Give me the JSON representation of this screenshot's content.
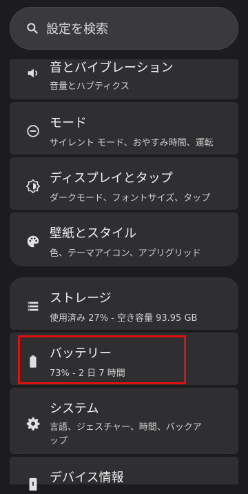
{
  "search": {
    "placeholder": "設定を検索"
  },
  "items": [
    {
      "title": "音とバイブレーション",
      "sub": "音量とハプティクス",
      "icon": "speaker-icon"
    },
    {
      "title": "モード",
      "sub": "サイレント モード、おやすみ時間、運転",
      "icon": "mode-circle-icon"
    },
    {
      "title": "ディスプレイとタップ",
      "sub": "ダークモード、フォントサイズ、タップ",
      "icon": "brightness-icon"
    },
    {
      "title": "壁紙とスタイル",
      "sub": "色、テーマアイコン、アプリグリッド",
      "icon": "palette-icon"
    },
    {
      "title": "ストレージ",
      "sub": "使用済み 27% - 空き容量 93.95 GB",
      "icon": "storage-icon"
    },
    {
      "title": "バッテリー",
      "sub": "73% - 2 日 7 時間",
      "icon": "battery-icon"
    },
    {
      "title": "システム",
      "sub": "言語、ジェスチャー、時間、バックアップ",
      "icon": "gear-icon"
    },
    {
      "title": "デバイス情報",
      "sub": "",
      "icon": "phone-icon"
    }
  ],
  "colors": {
    "background": "#1c1c1e",
    "card": "#2f2f31",
    "highlight": "#e01010"
  }
}
